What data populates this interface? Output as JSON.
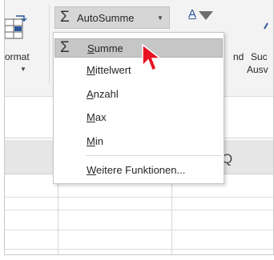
{
  "ribbon": {
    "format_label": "ormat",
    "autosum_label": "AutoSumme",
    "sort_label": "A",
    "right_text_1a": "nd",
    "right_text_1b": "Suc",
    "right_text_2": "Ausv"
  },
  "grid": {
    "column_header": "Q"
  },
  "dropdown": {
    "items": [
      {
        "label": "Summe",
        "selected": true
      },
      {
        "label": "Mittelwert"
      },
      {
        "label": "Anzahl"
      },
      {
        "label": "Max"
      },
      {
        "label": "Min"
      },
      {
        "label": "Weitere Funktionen..."
      }
    ]
  },
  "colors": {
    "ribbon_bg": "#f3f3f3",
    "selected_bg": "#c6c6c6",
    "cursor_red": "#e81123",
    "accent_blue": "#2b579a"
  }
}
